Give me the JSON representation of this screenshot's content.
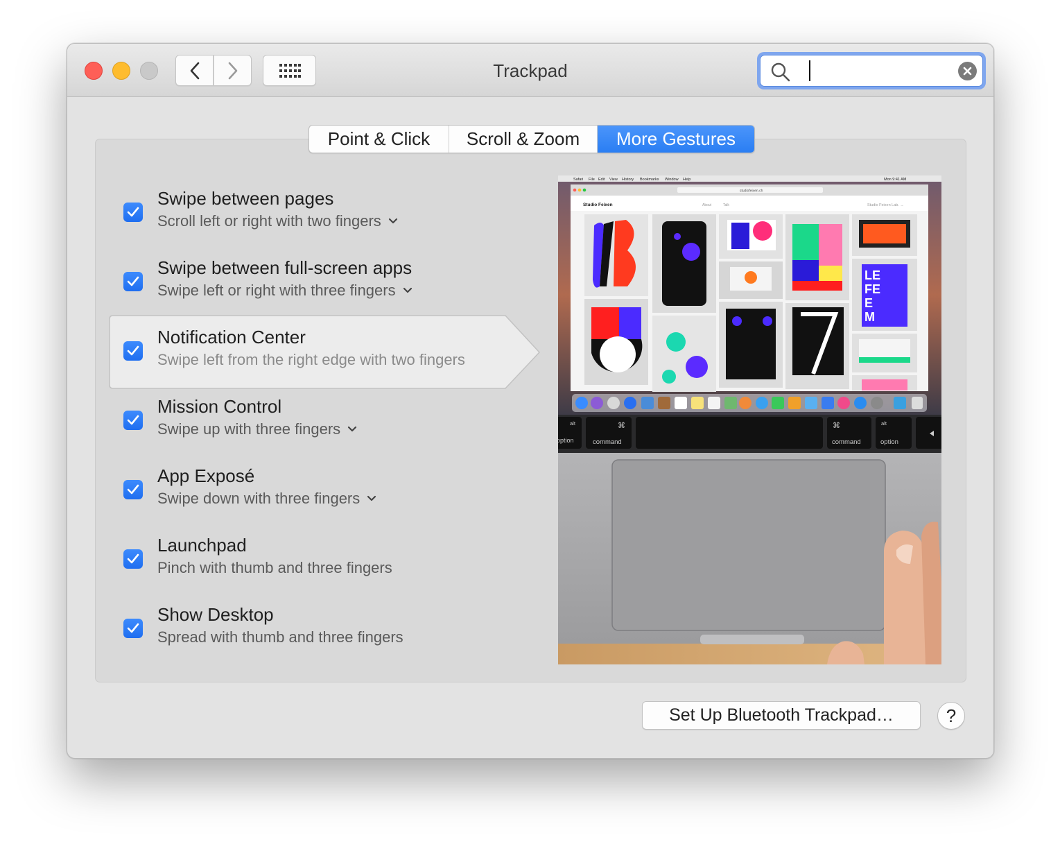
{
  "window": {
    "title": "Trackpad"
  },
  "search": {
    "value": "",
    "placeholder": ""
  },
  "tabs": [
    {
      "label": "Point & Click",
      "selected": false
    },
    {
      "label": "Scroll & Zoom",
      "selected": false
    },
    {
      "label": "More Gestures",
      "selected": true
    }
  ],
  "gestures": [
    {
      "title": "Swipe between pages",
      "description": "Scroll left or right with two fingers",
      "checked": true,
      "has_menu": true
    },
    {
      "title": "Swipe between full-screen apps",
      "description": "Swipe left or right with three fingers",
      "checked": true,
      "has_menu": true
    },
    {
      "title": "Notification Center",
      "description": "Swipe left from the right edge with two fingers",
      "checked": true,
      "has_menu": false,
      "highlighted": true
    },
    {
      "title": "Mission Control",
      "description": "Swipe up with three fingers",
      "checked": true,
      "has_menu": true
    },
    {
      "title": "App Exposé",
      "description": "Swipe down with three fingers",
      "checked": true,
      "has_menu": true
    },
    {
      "title": "Launchpad",
      "description": "Pinch with thumb and three fingers",
      "checked": true,
      "has_menu": false
    },
    {
      "title": "Show Desktop",
      "description": "Spread with thumb and three fingers",
      "checked": true,
      "has_menu": false
    }
  ],
  "preview": {
    "safari_menu": [
      "Safari",
      "File",
      "Edit",
      "View",
      "History",
      "Bookmarks",
      "Window",
      "Help"
    ],
    "menu_clock": "Mon 9:41 AM",
    "url": "studiofeixen.ch",
    "site_name": "Studio Feixen",
    "site_link": "Studio Feixen Lab. →",
    "site_nav": [
      "About",
      "Talk"
    ],
    "keys": {
      "left_option": "option",
      "left_alt": "alt",
      "left_command": "command",
      "right_command": "command",
      "right_option": "option",
      "right_alt": "alt",
      "cmd_symbol": "⌘"
    }
  },
  "footer": {
    "setup_button": "Set Up Bluetooth Trackpad…",
    "help_button": "?"
  },
  "colors": {
    "accent": "#2a7ef3",
    "close": "#fe5f57",
    "minimize": "#febc2e",
    "zoom_disabled": "#c9c9c9",
    "search_focus_ring": "#7fa6ee"
  }
}
